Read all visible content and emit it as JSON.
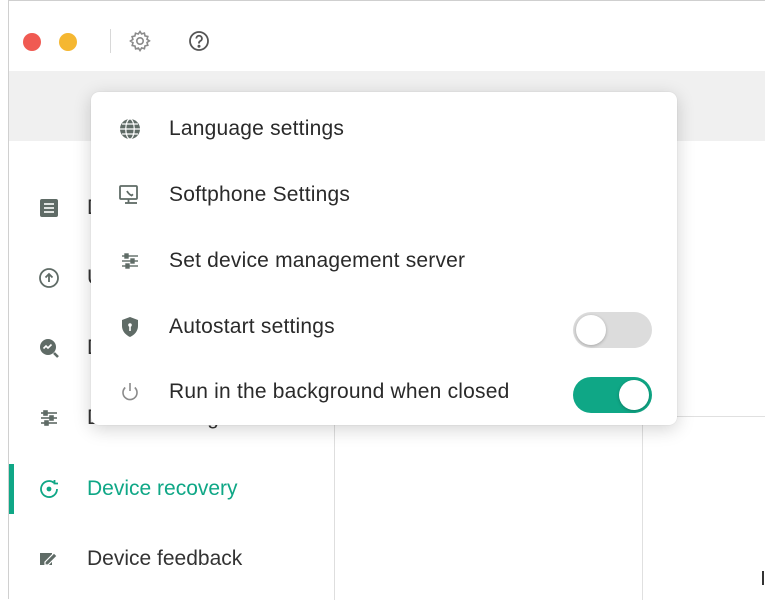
{
  "colors": {
    "accent": "#0fa786",
    "close_light": "#f05a52",
    "minimize_light": "#f5b731",
    "toggle_off": "#dcdcdc"
  },
  "titlebar": {
    "icons": [
      "gear-icon",
      "help-icon"
    ]
  },
  "settings_menu": {
    "items": [
      {
        "label": "Language settings",
        "icon": "globe-icon"
      },
      {
        "label": "Softphone Settings",
        "icon": "monitor-phone-icon"
      },
      {
        "label": "Set device management server",
        "icon": "sliders-icon"
      },
      {
        "label": "Autostart settings",
        "icon": "shield-icon",
        "toggle": false
      },
      {
        "label": "Run in the background when closed",
        "icon": "power-icon",
        "toggle": true
      }
    ]
  },
  "sidebar": {
    "items": [
      {
        "label": "D",
        "icon": "list-icon"
      },
      {
        "label": "U",
        "icon": "upload-circle-icon"
      },
      {
        "label": "D",
        "icon": "chart-search-icon"
      },
      {
        "label": "Device settings",
        "icon": "sliders-icon"
      },
      {
        "label": "Device recovery",
        "icon": "recovery-icon",
        "active": true
      },
      {
        "label": "Device feedback",
        "icon": "feedback-icon"
      }
    ]
  }
}
